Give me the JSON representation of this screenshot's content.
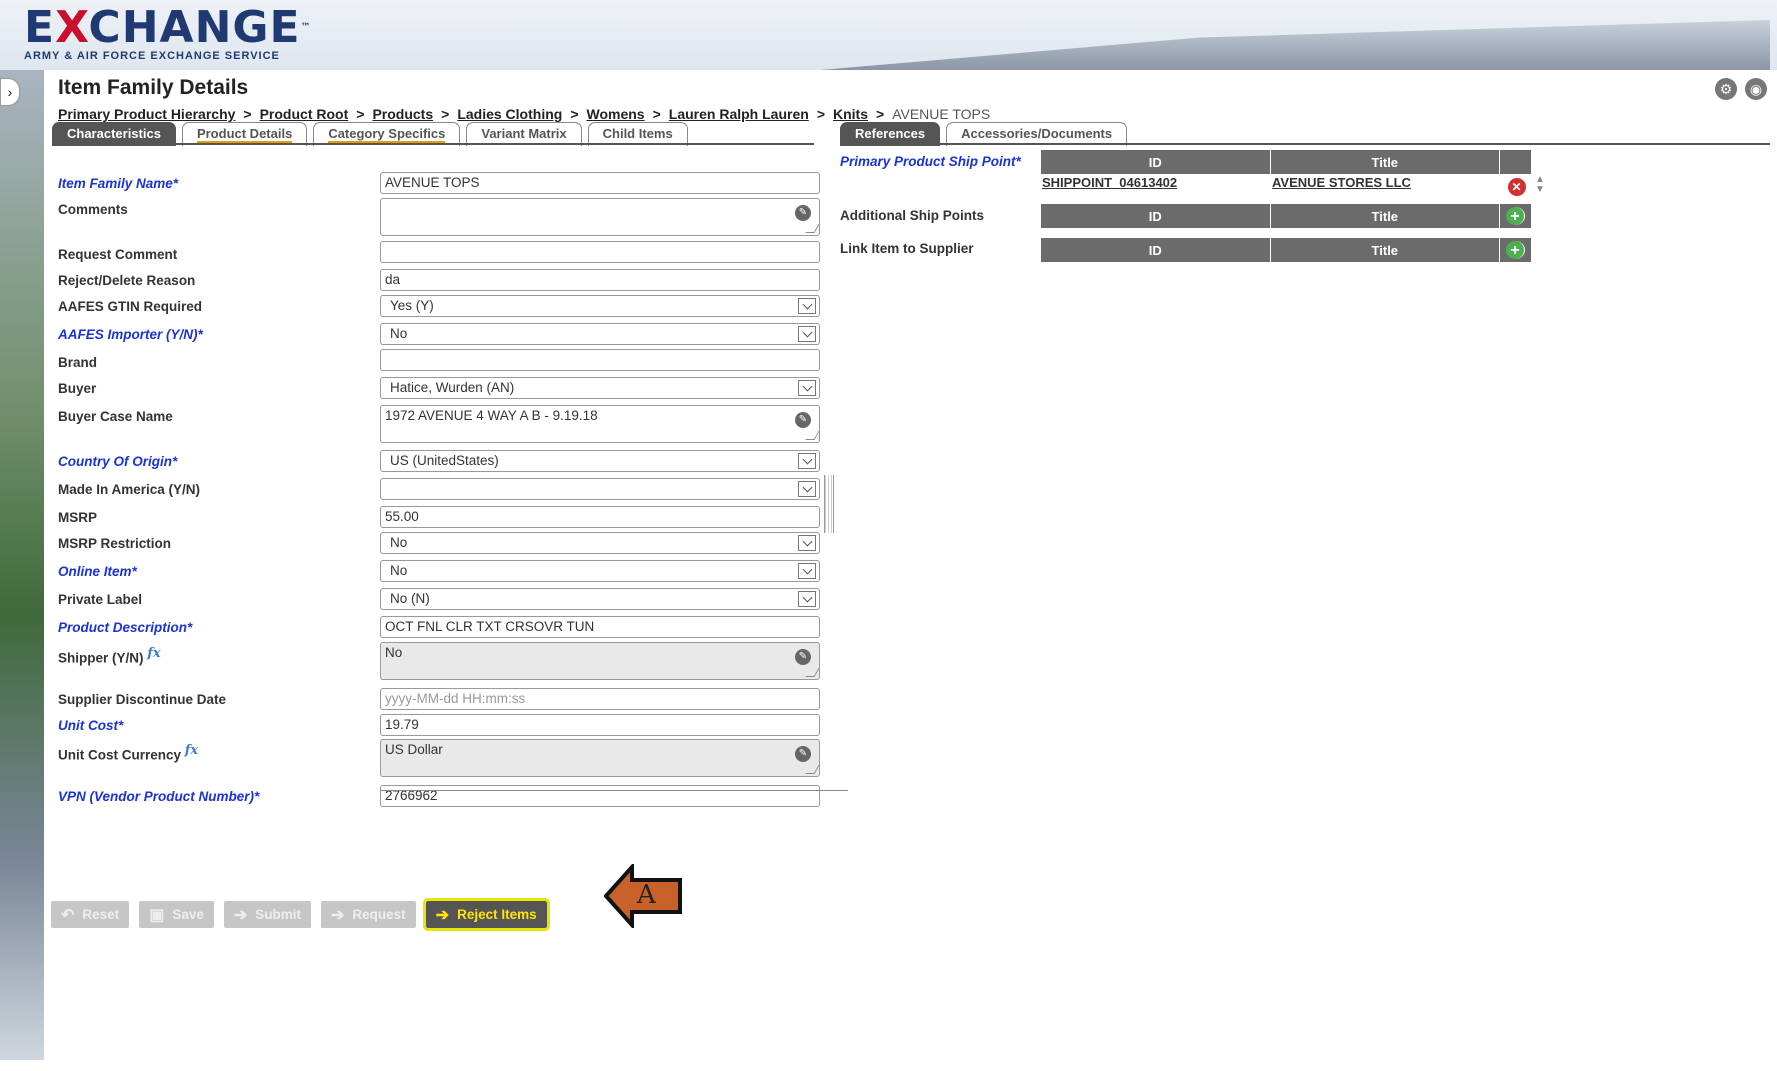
{
  "brand": {
    "word_a": "E",
    "word_x": "X",
    "word_rest": "CHANGE",
    "tm": "™",
    "subtitle": "ARMY & AIR FORCE EXCHANGE SERVICE"
  },
  "page": {
    "title": "Item Family Details"
  },
  "breadcrumb": {
    "links": [
      "Primary Product Hierarchy",
      "Product Root",
      "Products",
      "Ladies Clothing",
      "Womens",
      "Lauren Ralph Lauren",
      "Knits"
    ],
    "separator": ">",
    "current": "AVENUE TOPS"
  },
  "left_tabs": [
    "Characteristics",
    "Product Details",
    "Category Specifics",
    "Variant Matrix",
    "Child Items"
  ],
  "right_tabs": [
    "References",
    "Accessories/Documents"
  ],
  "fields": {
    "item_family_name": {
      "label": "Item Family Name*",
      "value": "AVENUE TOPS"
    },
    "comments": {
      "label": "Comments",
      "value": ""
    },
    "request_comment": {
      "label": "Request Comment",
      "value": ""
    },
    "reject_delete_reason": {
      "label": "Reject/Delete Reason",
      "value": "da"
    },
    "aafes_gtin_required": {
      "label": "AAFES GTIN Required",
      "value": "Yes (Y)"
    },
    "aafes_importer": {
      "label": "AAFES Importer (Y/N)*",
      "value": "No"
    },
    "brand": {
      "label": "Brand",
      "value": ""
    },
    "buyer": {
      "label": "Buyer",
      "value": "Hatice, Wurden (AN)"
    },
    "buyer_case_name": {
      "label": "Buyer Case Name",
      "value": "1972 AVENUE 4 WAY A B - 9.19.18"
    },
    "country_of_origin": {
      "label": "Country Of Origin*",
      "value": "US (UnitedStates)"
    },
    "made_in_america": {
      "label": "Made In America (Y/N)",
      "value": ""
    },
    "msrp": {
      "label": "MSRP",
      "value": "55.00"
    },
    "msrp_restriction": {
      "label": "MSRP Restriction",
      "value": "No"
    },
    "online_item": {
      "label": "Online Item*",
      "value": "No"
    },
    "private_label": {
      "label": "Private Label",
      "value": "No (N)"
    },
    "product_description": {
      "label": "Product Description*",
      "value": "OCT FNL CLR TXT CRSOVR TUN"
    },
    "shipper": {
      "label": "Shipper (Y/N)",
      "fx": "fx",
      "value": "No"
    },
    "supplier_discontinue_date": {
      "label": "Supplier Discontinue Date",
      "placeholder": "yyyy-MM-dd HH:mm:ss"
    },
    "unit_cost": {
      "label": "Unit Cost*",
      "value": "19.79"
    },
    "unit_cost_currency": {
      "label": "Unit Cost Currency",
      "fx": "fx",
      "value": "US Dollar"
    },
    "vpn": {
      "label": "VPN (Vendor Product Number)*",
      "value": "2766962"
    }
  },
  "references": {
    "primary_ship_point": {
      "label": "Primary Product Ship Point*",
      "col_id": "ID",
      "col_title": "Title",
      "row": {
        "id": "SHIPPOINT_04613402",
        "title": "AVENUE STORES LLC"
      }
    },
    "additional_ship_points": {
      "label": "Additional Ship Points",
      "col_id": "ID",
      "col_title": "Title"
    },
    "link_supplier": {
      "label": "Link Item to Supplier",
      "col_id": "ID",
      "col_title": "Title"
    }
  },
  "buttons": {
    "reset": "Reset",
    "save": "Save",
    "submit": "Submit",
    "request": "Request",
    "reject": "Reject Items"
  },
  "callout": {
    "label": "A"
  },
  "colors": {
    "required_label": "#1a33d6",
    "tab_active": "#555555",
    "callout_fill": "#c8622a",
    "highlight": "#e6e600"
  }
}
